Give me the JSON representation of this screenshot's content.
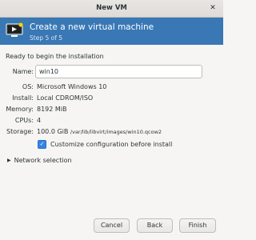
{
  "window": {
    "title": "New VM",
    "close_glyph": "✕"
  },
  "header": {
    "title": "Create a new virtual machine",
    "step": "Step 5 of 5",
    "background": "#3978b5",
    "icon": "monitor-play-icon"
  },
  "summary": {
    "intro": "Ready to begin the installation",
    "name_label": "Name:",
    "name_value": "win10",
    "os_label": "OS:",
    "os_value": "Microsoft Windows 10",
    "install_label": "Install:",
    "install_value": "Local CDROM/ISO",
    "memory_label": "Memory:",
    "memory_value": "8192 MiB",
    "cpus_label": "CPUs:",
    "cpus_value": "4",
    "storage_label": "Storage:",
    "storage_size": "100.0 GiB",
    "storage_path": "/var/lib/libvirt/images/win10.qcow2",
    "customize_label": "Customize configuration before install",
    "customize_checked": true
  },
  "network": {
    "label": "Network selection",
    "expanded": false
  },
  "buttons": {
    "cancel": "Cancel",
    "back": "Back",
    "finish": "Finish"
  }
}
